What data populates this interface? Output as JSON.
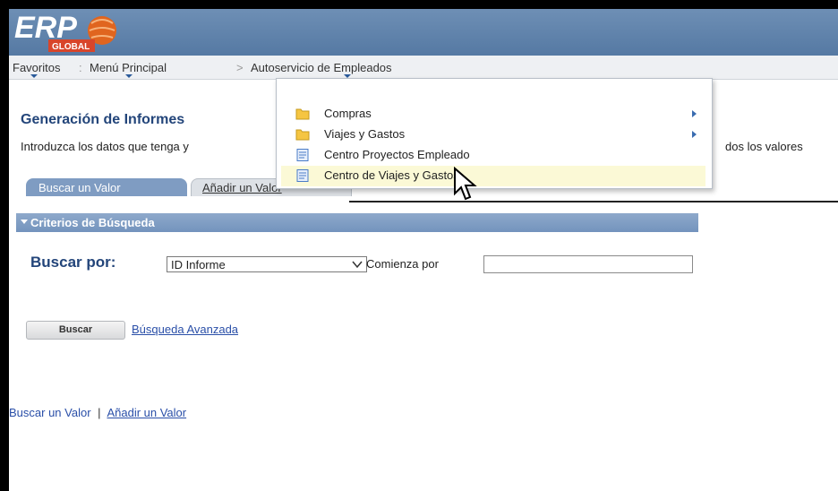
{
  "logo": {
    "wordmark": "ERP",
    "sub": "GLOBAL"
  },
  "nav": {
    "favorites": "Favoritos",
    "sep1": ":",
    "main_menu": "Menú Principal",
    "sep2": ">",
    "employee_self_service": "Autoservicio de Empleados"
  },
  "dropdown": {
    "items": [
      {
        "label": "Compras",
        "icon": "folder-icon",
        "submenu": true
      },
      {
        "label": "Viajes y Gastos",
        "icon": "folder-icon",
        "submenu": true
      },
      {
        "label": "Centro Proyectos Empleado",
        "icon": "document-icon",
        "submenu": false
      },
      {
        "label": "Centro de Viajes y Gastos",
        "icon": "document-icon",
        "submenu": false,
        "highlighted": true
      }
    ]
  },
  "page": {
    "title": "Generación de Informes",
    "instructions_left": "Introduzca los datos que tenga y",
    "instructions_right": "dos los valores"
  },
  "tabs": {
    "search": "Buscar un Valor",
    "add": "Añadir un Valor"
  },
  "criteria": {
    "header": "Criterios de Búsqueda",
    "search_by_label": "Buscar por:",
    "search_by_value": "ID Informe",
    "begins_with_label": "Comienza por",
    "begins_with_value": ""
  },
  "actions": {
    "search_button": "Buscar",
    "advanced_search": "Búsqueda Avanzada"
  },
  "footer_links": {
    "search": "Buscar un Valor",
    "separator": "|",
    "add": "Añadir un Valor"
  },
  "colors": {
    "banner": "#5f82ac",
    "title": "#23457a",
    "link": "#2a4fa8",
    "highlight": "#fbf9d6"
  }
}
